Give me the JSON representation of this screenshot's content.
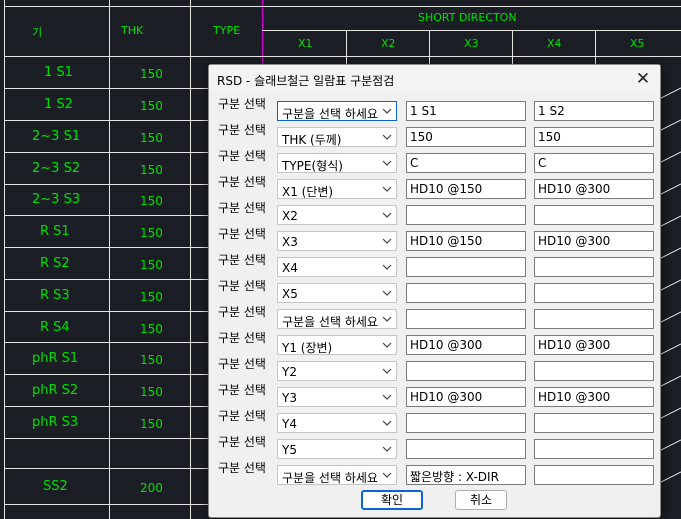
{
  "background_table": {
    "headers": {
      "col1": "기",
      "col2": "THK",
      "col3": "TYPE",
      "group": "SHORT DIRECTON",
      "sub": [
        "X1",
        "X2",
        "X3",
        "X4",
        "X5"
      ]
    },
    "rows": [
      {
        "name": "1 S1",
        "thk": "150"
      },
      {
        "name": "1 S2",
        "thk": "150"
      },
      {
        "name": "2~3 S1",
        "thk": "150"
      },
      {
        "name": "2~3 S2",
        "thk": "150"
      },
      {
        "name": "2~3 S3",
        "thk": "150"
      },
      {
        "name": "R S1",
        "thk": "150"
      },
      {
        "name": "R S2",
        "thk": "150"
      },
      {
        "name": "R S3",
        "thk": "150"
      },
      {
        "name": "R S4",
        "thk": "150"
      },
      {
        "name": "phR S1",
        "thk": "150"
      },
      {
        "name": "phR S2",
        "thk": "150"
      },
      {
        "name": "phR S3",
        "thk": "150"
      },
      {
        "name": "",
        "thk": ""
      },
      {
        "name": "SS2",
        "thk": "200"
      }
    ]
  },
  "dialog": {
    "title": "RSD - 슬래브철근 일람표 구분점검",
    "close_glyph": "✕",
    "rows": [
      {
        "label": "구분 선택",
        "combo": "구분을 선택 하세요",
        "v1": "1 S1",
        "v2": "1 S2"
      },
      {
        "label": "구분 선택",
        "combo": "THK (두께)",
        "v1": "150",
        "v2": "150"
      },
      {
        "label": "구분 선택",
        "combo": "TYPE(형식)",
        "v1": "C",
        "v2": "C"
      },
      {
        "label": "구분 선택",
        "combo": "X1 (단변)",
        "v1": "HD10 @150",
        "v2": "HD10 @300"
      },
      {
        "label": "구분 선택",
        "combo": "X2",
        "v1": "",
        "v2": ""
      },
      {
        "label": "구분 선택",
        "combo": "X3",
        "v1": "HD10 @150",
        "v2": "HD10 @300"
      },
      {
        "label": "구분 선택",
        "combo": "X4",
        "v1": "",
        "v2": ""
      },
      {
        "label": "구분 선택",
        "combo": "X5",
        "v1": "",
        "v2": ""
      },
      {
        "label": "구분 선택",
        "combo": "구분을 선택 하세요",
        "v1": "",
        "v2": ""
      },
      {
        "label": "구분 선택",
        "combo": "Y1 (장변)",
        "v1": "HD10 @300",
        "v2": "HD10 @300"
      },
      {
        "label": "구분 선택",
        "combo": "Y2",
        "v1": "",
        "v2": ""
      },
      {
        "label": "구분 선택",
        "combo": "Y3",
        "v1": "HD10 @300",
        "v2": "HD10 @300"
      },
      {
        "label": "구분 선택",
        "combo": "Y4",
        "v1": "",
        "v2": ""
      },
      {
        "label": "구분 선택",
        "combo": "Y5",
        "v1": "",
        "v2": ""
      },
      {
        "label": "구분 선택",
        "combo": "구분을 선택 하세요",
        "v1": "짧은방향 : X-DIR",
        "v2": ""
      }
    ],
    "ok_label": "확인",
    "cancel_label": "취소"
  },
  "colors": {
    "cad_text": "#00e000",
    "cad_line": "#e6e6e6",
    "accent": "#0a64d6"
  }
}
